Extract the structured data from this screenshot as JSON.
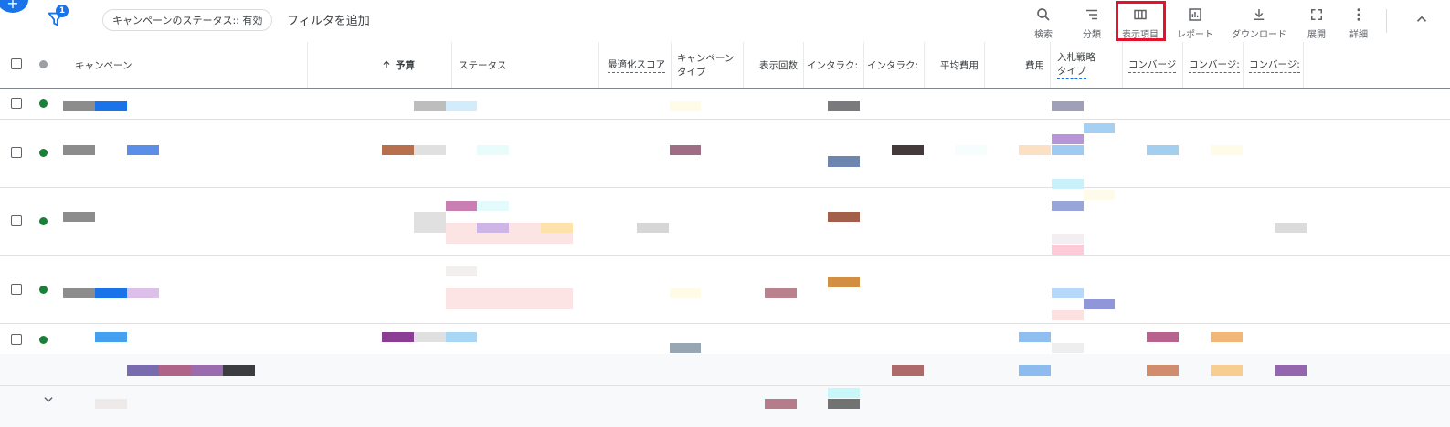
{
  "toolbar": {
    "filter_badge": "1",
    "status_chip": "キャンペーンのステータス:: 有効",
    "add_filter": "フィルタを追加",
    "tools": {
      "search": "検索",
      "segment": "分類",
      "columns": "表示項目",
      "reports": "レポート",
      "download": "ダウンロード",
      "expand": "展開",
      "more": "詳細"
    }
  },
  "table": {
    "headers": {
      "campaign": "キャンペーン",
      "budget": "予算",
      "status": "ステータス",
      "optimization_score": "最適化スコア",
      "campaign_type_1": "キャンペーン",
      "campaign_type_2": "タイプ",
      "impressions": "表示回数",
      "interactions": "インタラク:",
      "interaction_rate": "インタラク:",
      "avg_cost": "平均費用",
      "cost": "費用",
      "bid_strategy_1": "入札戦略",
      "bid_strategy_2": "タイプ",
      "conversions_1": "コンバージ",
      "conversions_2": "コンバージ:",
      "conversions_3": "コンバージ:"
    },
    "sort_column": "予算"
  },
  "colors": {
    "accent": "#1a73e8",
    "enabled_status": "#188038",
    "highlight": "#e8112d"
  }
}
